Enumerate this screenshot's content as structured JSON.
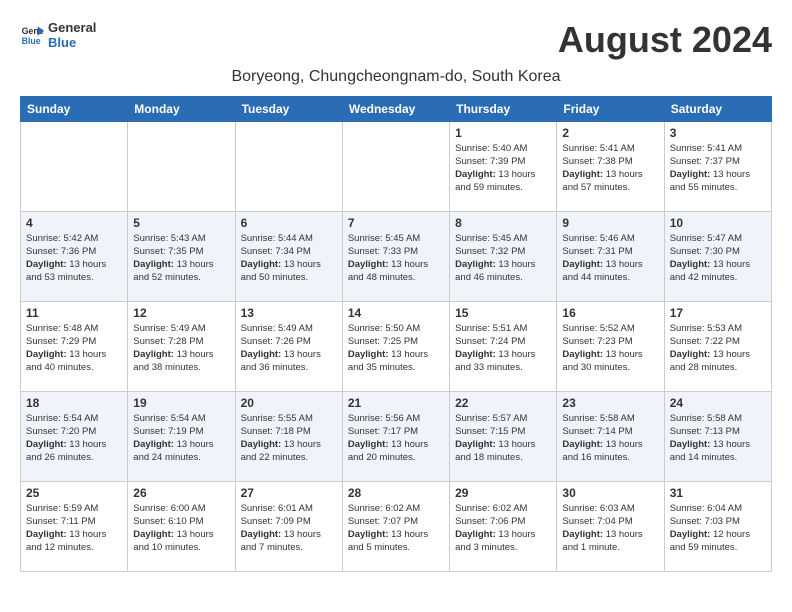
{
  "header": {
    "logo_line1": "General",
    "logo_line2": "Blue",
    "month_year": "August 2024",
    "location": "Boryeong, Chungcheongnam-do, South Korea"
  },
  "weekdays": [
    "Sunday",
    "Monday",
    "Tuesday",
    "Wednesday",
    "Thursday",
    "Friday",
    "Saturday"
  ],
  "weeks": [
    [
      {
        "day": "",
        "content": ""
      },
      {
        "day": "",
        "content": ""
      },
      {
        "day": "",
        "content": ""
      },
      {
        "day": "",
        "content": ""
      },
      {
        "day": "1",
        "content": "Sunrise: 5:40 AM\nSunset: 7:39 PM\nDaylight: 13 hours and 59 minutes."
      },
      {
        "day": "2",
        "content": "Sunrise: 5:41 AM\nSunset: 7:38 PM\nDaylight: 13 hours and 57 minutes."
      },
      {
        "day": "3",
        "content": "Sunrise: 5:41 AM\nSunset: 7:37 PM\nDaylight: 13 hours and 55 minutes."
      }
    ],
    [
      {
        "day": "4",
        "content": "Sunrise: 5:42 AM\nSunset: 7:36 PM\nDaylight: 13 hours and 53 minutes."
      },
      {
        "day": "5",
        "content": "Sunrise: 5:43 AM\nSunset: 7:35 PM\nDaylight: 13 hours and 52 minutes."
      },
      {
        "day": "6",
        "content": "Sunrise: 5:44 AM\nSunset: 7:34 PM\nDaylight: 13 hours and 50 minutes."
      },
      {
        "day": "7",
        "content": "Sunrise: 5:45 AM\nSunset: 7:33 PM\nDaylight: 13 hours and 48 minutes."
      },
      {
        "day": "8",
        "content": "Sunrise: 5:45 AM\nSunset: 7:32 PM\nDaylight: 13 hours and 46 minutes."
      },
      {
        "day": "9",
        "content": "Sunrise: 5:46 AM\nSunset: 7:31 PM\nDaylight: 13 hours and 44 minutes."
      },
      {
        "day": "10",
        "content": "Sunrise: 5:47 AM\nSunset: 7:30 PM\nDaylight: 13 hours and 42 minutes."
      }
    ],
    [
      {
        "day": "11",
        "content": "Sunrise: 5:48 AM\nSunset: 7:29 PM\nDaylight: 13 hours and 40 minutes."
      },
      {
        "day": "12",
        "content": "Sunrise: 5:49 AM\nSunset: 7:28 PM\nDaylight: 13 hours and 38 minutes."
      },
      {
        "day": "13",
        "content": "Sunrise: 5:49 AM\nSunset: 7:26 PM\nDaylight: 13 hours and 36 minutes."
      },
      {
        "day": "14",
        "content": "Sunrise: 5:50 AM\nSunset: 7:25 PM\nDaylight: 13 hours and 35 minutes."
      },
      {
        "day": "15",
        "content": "Sunrise: 5:51 AM\nSunset: 7:24 PM\nDaylight: 13 hours and 33 minutes."
      },
      {
        "day": "16",
        "content": "Sunrise: 5:52 AM\nSunset: 7:23 PM\nDaylight: 13 hours and 30 minutes."
      },
      {
        "day": "17",
        "content": "Sunrise: 5:53 AM\nSunset: 7:22 PM\nDaylight: 13 hours and 28 minutes."
      }
    ],
    [
      {
        "day": "18",
        "content": "Sunrise: 5:54 AM\nSunset: 7:20 PM\nDaylight: 13 hours and 26 minutes."
      },
      {
        "day": "19",
        "content": "Sunrise: 5:54 AM\nSunset: 7:19 PM\nDaylight: 13 hours and 24 minutes."
      },
      {
        "day": "20",
        "content": "Sunrise: 5:55 AM\nSunset: 7:18 PM\nDaylight: 13 hours and 22 minutes."
      },
      {
        "day": "21",
        "content": "Sunrise: 5:56 AM\nSunset: 7:17 PM\nDaylight: 13 hours and 20 minutes."
      },
      {
        "day": "22",
        "content": "Sunrise: 5:57 AM\nSunset: 7:15 PM\nDaylight: 13 hours and 18 minutes."
      },
      {
        "day": "23",
        "content": "Sunrise: 5:58 AM\nSunset: 7:14 PM\nDaylight: 13 hours and 16 minutes."
      },
      {
        "day": "24",
        "content": "Sunrise: 5:58 AM\nSunset: 7:13 PM\nDaylight: 13 hours and 14 minutes."
      }
    ],
    [
      {
        "day": "25",
        "content": "Sunrise: 5:59 AM\nSunset: 7:11 PM\nDaylight: 13 hours and 12 minutes."
      },
      {
        "day": "26",
        "content": "Sunrise: 6:00 AM\nSunset: 6:10 PM\nDaylight: 13 hours and 10 minutes."
      },
      {
        "day": "27",
        "content": "Sunrise: 6:01 AM\nSunset: 7:09 PM\nDaylight: 13 hours and 7 minutes."
      },
      {
        "day": "28",
        "content": "Sunrise: 6:02 AM\nSunset: 7:07 PM\nDaylight: 13 hours and 5 minutes."
      },
      {
        "day": "29",
        "content": "Sunrise: 6:02 AM\nSunset: 7:06 PM\nDaylight: 13 hours and 3 minutes."
      },
      {
        "day": "30",
        "content": "Sunrise: 6:03 AM\nSunset: 7:04 PM\nDaylight: 13 hours and 1 minute."
      },
      {
        "day": "31",
        "content": "Sunrise: 6:04 AM\nSunset: 7:03 PM\nDaylight: 12 hours and 59 minutes."
      }
    ]
  ]
}
